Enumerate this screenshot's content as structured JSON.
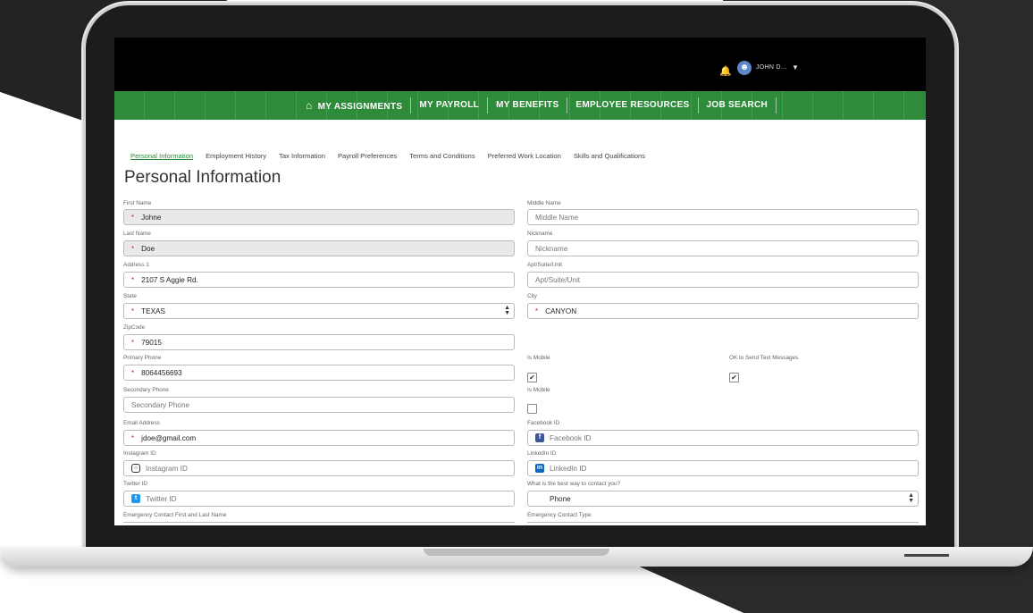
{
  "topbar": {
    "username": "JOHN D...",
    "caret": "▼",
    "bell_icon": "bell-icon",
    "avatar_icon": "user-avatar-icon"
  },
  "nav": {
    "home_icon": "home-icon",
    "items": [
      "MY ASSIGNMENTS",
      "MY PAYROLL",
      "MY BENEFITS",
      "EMPLOYEE RESOURCES",
      "JOB SEARCH"
    ]
  },
  "tabs": [
    "Personal Information",
    "Employment History",
    "Tax Information",
    "Payroll Preferences",
    "Terms and Conditions",
    "Preferred Work Location",
    "Skills and Qualifications"
  ],
  "page_title": "Personal Information",
  "form": {
    "first_name": {
      "label": "First Name",
      "value": "Johne"
    },
    "middle_name": {
      "label": "Middle Name",
      "placeholder": "Middle Name"
    },
    "last_name": {
      "label": "Last Name",
      "value": "Doe"
    },
    "nickname": {
      "label": "Nickname",
      "placeholder": "Nickname"
    },
    "address1": {
      "label": "Address 1",
      "value": "2107 S Aggie Rd."
    },
    "apt": {
      "label": "Apt/Suite/Unit",
      "placeholder": "Apt/Suite/Unit"
    },
    "state": {
      "label": "State",
      "value": "TEXAS"
    },
    "city": {
      "label": "City",
      "value": "CANYON"
    },
    "zipcode": {
      "label": "ZipCode",
      "value": "79015"
    },
    "primary_phone": {
      "label": "Primary Phone",
      "value": "8064456693"
    },
    "is_mobile_1": {
      "label": "Is Mobile",
      "checked": true
    },
    "ok_text": {
      "label": "OK to Send Text Messages",
      "checked": true
    },
    "secondary_phone": {
      "label": "Secondary Phone",
      "placeholder": "Secondary Phone"
    },
    "is_mobile_2": {
      "label": "Is Mobile",
      "checked": false
    },
    "email": {
      "label": "Email Address",
      "value": "jdoe@gmail.com"
    },
    "facebook": {
      "label": "Facebook ID",
      "placeholder": "Facebook ID"
    },
    "instagram": {
      "label": "Instagram ID",
      "placeholder": "Instagram ID"
    },
    "linkedin": {
      "label": "LinkedIn ID",
      "placeholder": "LinkedIn ID"
    },
    "twitter": {
      "label": "Twitter ID",
      "placeholder": "Twitter ID"
    },
    "contact_way": {
      "label": "What is the best way to contact you?",
      "value": "Phone"
    },
    "emergency_name": {
      "label": "Emergency Contact First and Last Name"
    },
    "emergency_type": {
      "label": "Emergency Contact Type"
    }
  },
  "required_marker": "*",
  "check_mark": "✔",
  "colors": {
    "nav_green": "#2e8b3a",
    "topbar": "#000000",
    "required": "#c4262e"
  }
}
